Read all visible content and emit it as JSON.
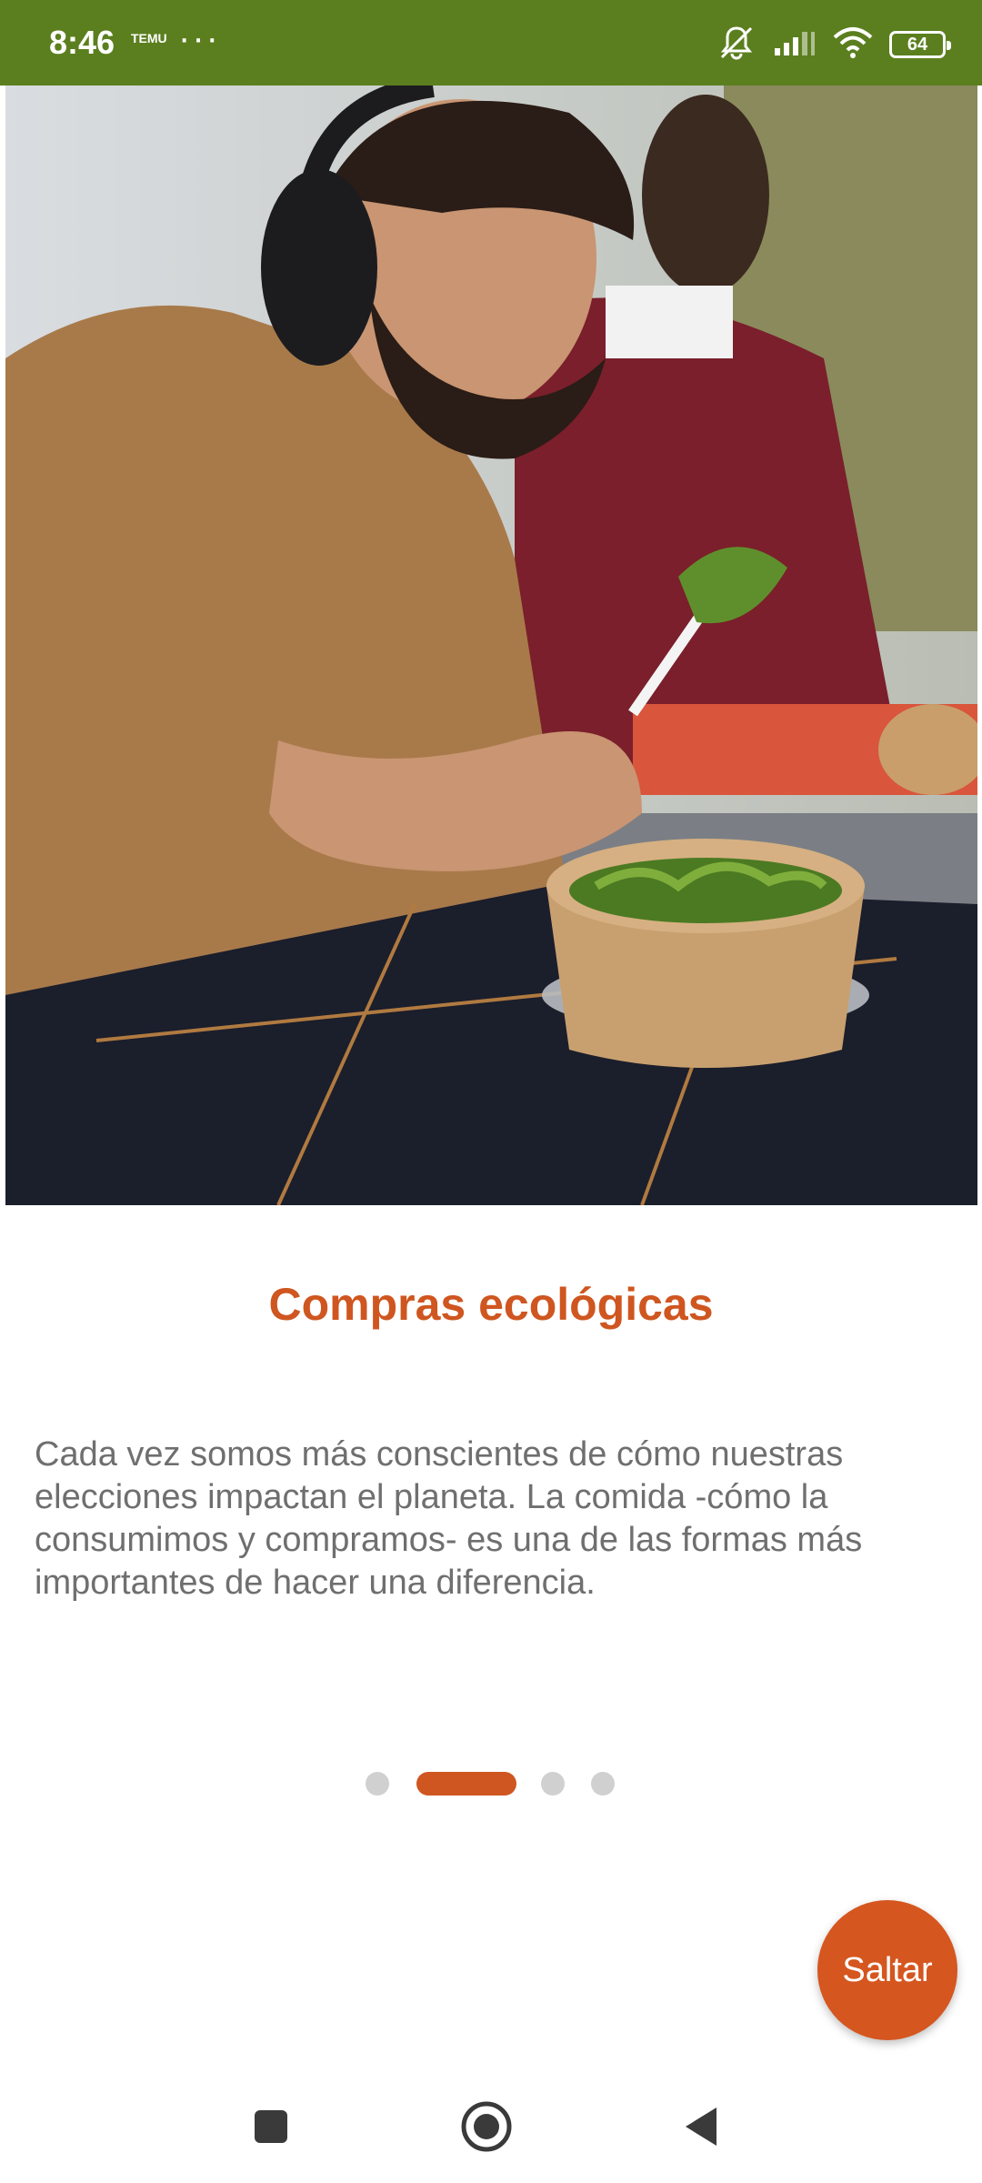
{
  "status_bar": {
    "time": "8:46",
    "carrier_badge": "TEMU",
    "more_indicator": "···",
    "battery_level": "64"
  },
  "hero": {
    "image_alt": "Hombre con auriculares comiendo ensalada de un recipiente de cartón"
  },
  "onboarding": {
    "title": "Compras ecológicas",
    "description": "Cada vez somos más conscientes de cómo nuestras elecciones impactan el planeta. La comida -cómo la consumimos y compramos- es una de las formas más importantes de hacer una diferencia.",
    "page_count": 4,
    "current_page": 2
  },
  "actions": {
    "skip_label": "Saltar"
  },
  "nav_bar": {
    "items": [
      "recents-button",
      "home-button",
      "back-button"
    ]
  },
  "colors": {
    "status_bar": "#5b7f1e",
    "accent": "#cf5620",
    "body_text": "#6f6f6f",
    "dot_inactive": "#d0d0d0"
  }
}
